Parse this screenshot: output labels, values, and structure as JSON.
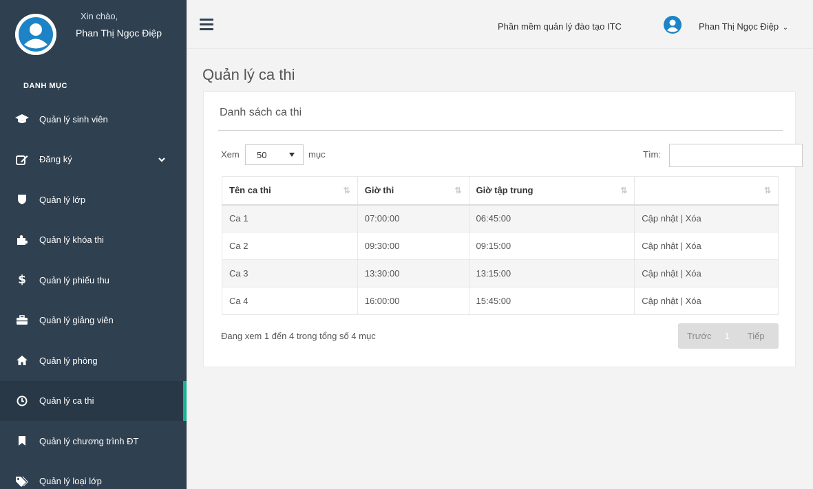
{
  "sidebar": {
    "greeting": "Xin chào,",
    "user_name": "Phan Thị Ngọc Điệp",
    "menu_title": "DANH MỤC",
    "items": [
      {
        "label": "Quản lý sinh viên",
        "icon": "graduation-cap-icon"
      },
      {
        "label": "Đăng ký",
        "icon": "edit-icon"
      },
      {
        "label": "Quản lý lớp",
        "icon": "shield-icon"
      },
      {
        "label": "Quản lý khóa thi",
        "icon": "puzzle-icon"
      },
      {
        "label": "Quản lý phiếu thu",
        "icon": "dollar-icon"
      },
      {
        "label": "Quản lý giảng viên",
        "icon": "briefcase-icon"
      },
      {
        "label": "Quản lý phòng",
        "icon": "home-icon"
      },
      {
        "label": "Quản lý ca thi",
        "icon": "clock-icon",
        "active": true
      },
      {
        "label": "Quản lý chương trình ĐT",
        "icon": "bookmark-icon"
      },
      {
        "label": "Quản lý loại lớp",
        "icon": "tags-icon"
      }
    ]
  },
  "topbar": {
    "app_name": "Phần mềm quản lý đào tạo ITC",
    "user_name": "Phan Thị Ngọc Điệp"
  },
  "page": {
    "title": "Quản lý ca thi"
  },
  "panel": {
    "title": "Danh sách ca thi",
    "length_label_before": "Xem",
    "length_value": "50",
    "length_label_after": "mục",
    "search_label": "Tìm:",
    "search_value": "",
    "columns": [
      "Tên ca thi",
      "Giờ thi",
      "Giờ tập trung",
      ""
    ],
    "rows": [
      {
        "name": "Ca 1",
        "time": "07:00:00",
        "gather": "06:45:00",
        "actions": "Cập nhật | Xóa"
      },
      {
        "name": "Ca 2",
        "time": "09:30:00",
        "gather": "09:15:00",
        "actions": "Cập nhật | Xóa"
      },
      {
        "name": "Ca 3",
        "time": "13:30:00",
        "gather": "13:15:00",
        "actions": "Cập nhật | Xóa"
      },
      {
        "name": "Ca 4",
        "time": "16:00:00",
        "gather": "15:45:00",
        "actions": "Cập nhật | Xóa"
      }
    ],
    "info": "Đang xem 1 đến 4 trong tổng số 4 mục",
    "pager": {
      "prev": "Trước",
      "current": "1",
      "next": "Tiếp"
    }
  },
  "colors": {
    "sidebar_bg": "#2f4050",
    "active_accent": "#1ab394",
    "avatar_blue": "#1c84c6"
  }
}
